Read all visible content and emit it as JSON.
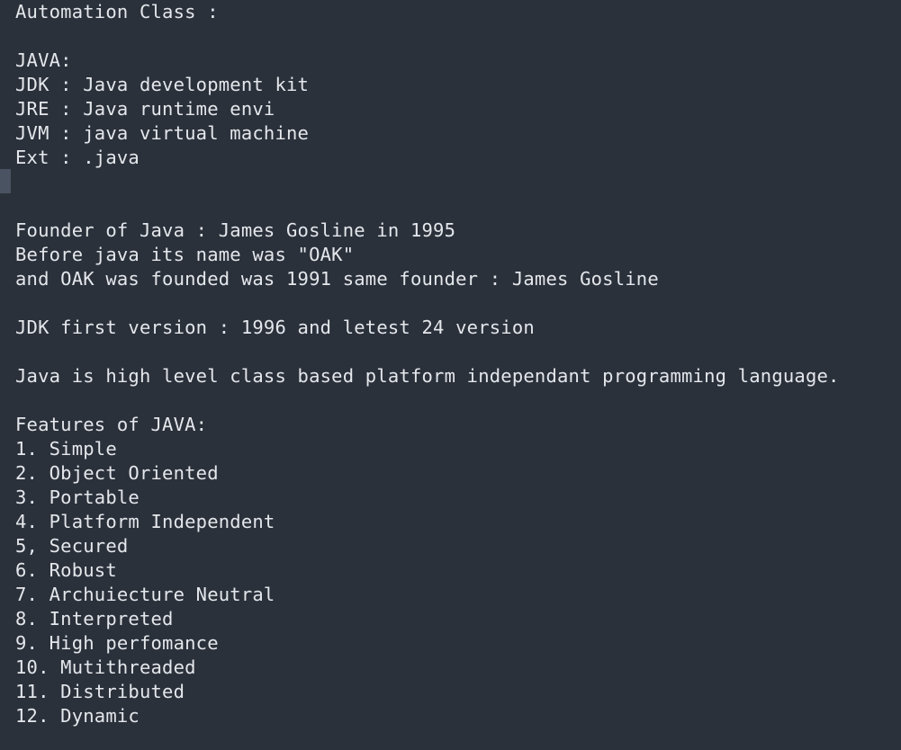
{
  "editor": {
    "lines": [
      "Automation Class :",
      "",
      "JAVA:",
      "JDK : Java development kit",
      "JRE : Java runtime envi",
      "JVM : java virtual machine",
      "Ext : .java",
      "",
      "",
      "Founder of Java : James Gosline in 1995",
      "Before java its name was \"OAK\"",
      "and OAK was founded was 1991 same founder : James Gosline",
      "",
      "JDK first version : 1996 and letest 24 version",
      "",
      "Java is high level class based platform independant programming language.",
      "",
      "Features of JAVA:",
      "1. Simple",
      "2. Object Oriented",
      "3. Portable",
      "4. Platform Independent",
      "5, Secured",
      "6. Robust",
      "7. Archuiecture Neutral",
      "8. Interpreted",
      "9. High perfomance",
      "10. Mutithreaded",
      "11. Distributed",
      "12. Dynamic"
    ]
  }
}
